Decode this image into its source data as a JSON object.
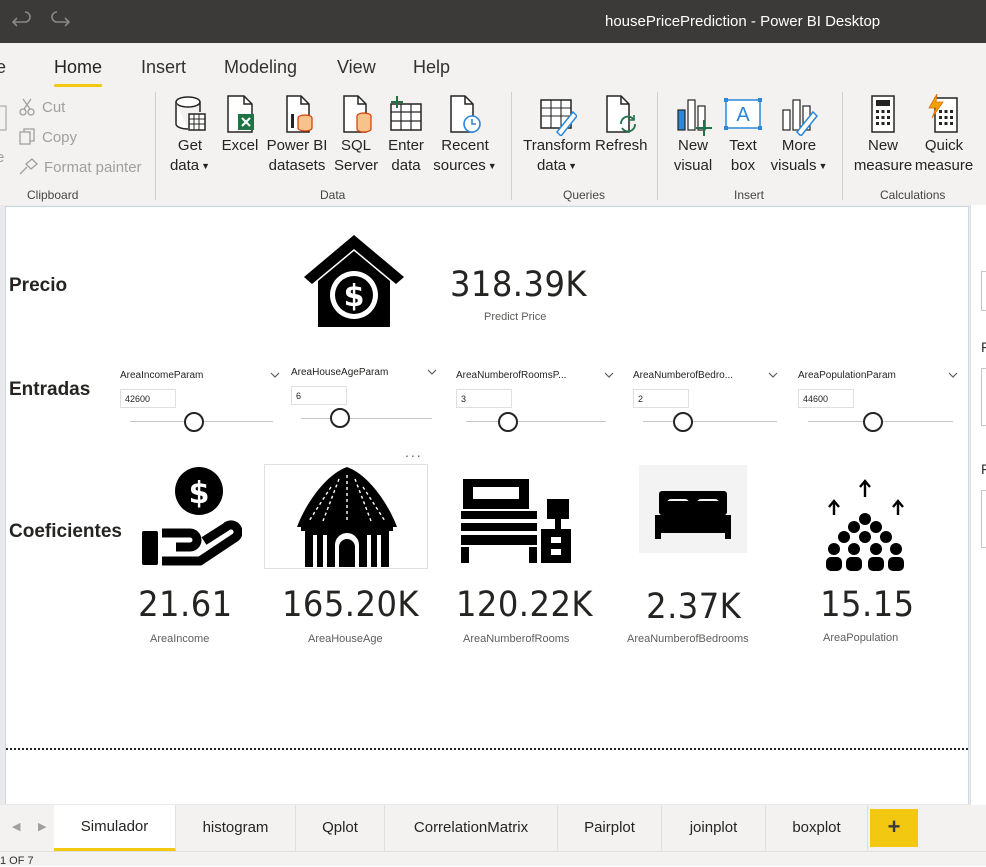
{
  "window": {
    "title": "housePricePrediction - Power BI Desktop"
  },
  "menu": {
    "tabs": [
      "e",
      "Home",
      "Insert",
      "Modeling",
      "View",
      "Help"
    ],
    "active": "Home"
  },
  "ribbon": {
    "clipboard": {
      "items": [
        "Cut",
        "Copy",
        "Format painter"
      ],
      "paste_partial": "e",
      "label": "Clipboard"
    },
    "data": {
      "label": "Data",
      "buttons": [
        {
          "line1": "Get",
          "line2": "data"
        },
        {
          "line1": "Excel",
          "line2": ""
        },
        {
          "line1": "Power BI",
          "line2": "datasets"
        },
        {
          "line1": "SQL",
          "line2": "Server"
        },
        {
          "line1": "Enter",
          "line2": "data"
        },
        {
          "line1": "Recent",
          "line2": "sources"
        }
      ]
    },
    "queries": {
      "label": "Queries",
      "buttons": [
        {
          "line1": "Transform",
          "line2": "data"
        },
        {
          "line1": "Refresh",
          "line2": ""
        }
      ]
    },
    "insert": {
      "label": "Insert",
      "buttons": [
        {
          "line1": "New",
          "line2": "visual"
        },
        {
          "line1": "Text",
          "line2": "box"
        },
        {
          "line1": "More",
          "line2": "visuals"
        }
      ]
    },
    "calculations": {
      "label": "Calculations",
      "buttons": [
        {
          "line1": "New",
          "line2": "measure"
        },
        {
          "line1": "Quick",
          "line2": "measure"
        }
      ]
    }
  },
  "report": {
    "sections": {
      "precio": "Precio",
      "entradas": "Entradas",
      "coeficientes": "Coeficientes"
    },
    "prediction": {
      "value": "318.39K",
      "label": "Predict Price"
    },
    "slicers": [
      {
        "title": "AreaIncomeParam",
        "value": "42600",
        "level": 0.45
      },
      {
        "title": "AreaHouseAgeParam",
        "value": "6",
        "level": 0.3
      },
      {
        "title": "AreaNumberofRoomsP...",
        "value": "3",
        "level": 0.3
      },
      {
        "title": "AreaNumberofBedro...",
        "value": "2",
        "level": 0.3
      },
      {
        "title": "AreaPopulationParam",
        "value": "44600",
        "level": 0.45
      }
    ],
    "coefficients": [
      {
        "value": "21.61",
        "label": "AreaIncome",
        "icon": "income-hand-icon"
      },
      {
        "value": "165.20K",
        "label": "AreaHouseAge",
        "icon": "hut-icon"
      },
      {
        "value": "120.22K",
        "label": "AreaNumberofRooms",
        "icon": "furniture-rooms-icon"
      },
      {
        "value": "2.37K",
        "label": "AreaNumberofBedrooms",
        "icon": "bed-icon"
      },
      {
        "value": "15.15",
        "label": "AreaPopulation",
        "icon": "population-icon"
      }
    ],
    "more_options": "...",
    "right_pane_letters": [
      "F",
      "F"
    ]
  },
  "page_tabs": {
    "tabs": [
      "Simulador",
      "histogram",
      "Qplot",
      "CorrelationMatrix",
      "Pairplot",
      "joinplot",
      "boxplot"
    ],
    "active": "Simulador",
    "add_label": "+"
  },
  "status": {
    "page_indicator": "1 OF 7"
  },
  "colors": {
    "titlebar": "#3b3a39",
    "accent": "#f2c811",
    "ribbon_bg": "#f3f2f1",
    "excel_green": "#217346",
    "icon_blue": "#2b88d8"
  }
}
